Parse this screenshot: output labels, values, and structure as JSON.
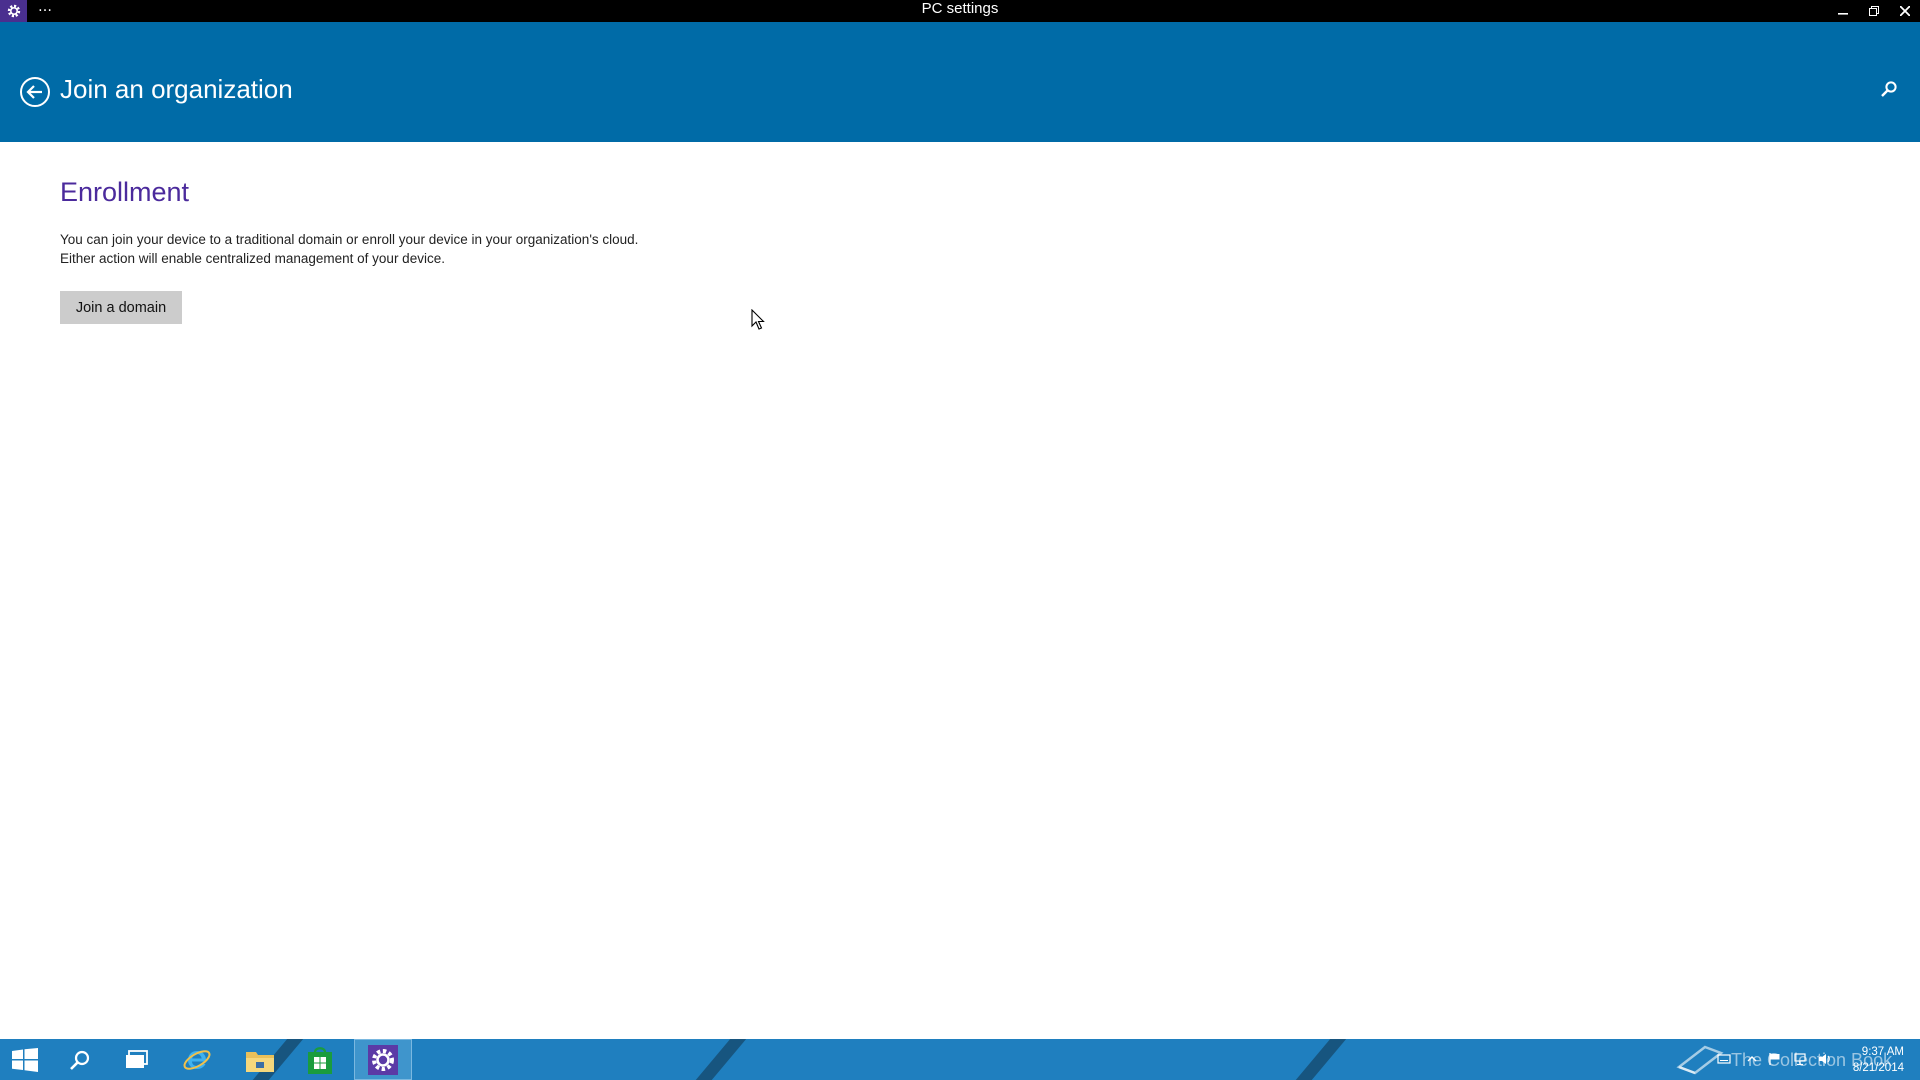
{
  "window": {
    "title": "PC settings",
    "menu_glyph": "…",
    "app_icon": "gear-icon",
    "controls": [
      "minimize-icon",
      "restore-icon",
      "close-icon"
    ]
  },
  "header": {
    "back_icon": "back-arrow-icon",
    "title": "Join an organization",
    "search_icon": "search-icon"
  },
  "content": {
    "heading": "Enrollment",
    "description": "You can join your device to a traditional domain or enroll your device in your organization's cloud.  Either action will enable centralized management of your device.",
    "join_button_label": "Join a domain"
  },
  "taskbar": {
    "items": [
      "start-icon",
      "search-icon",
      "task-view-icon",
      "internet-explorer-icon",
      "file-explorer-icon",
      "store-icon",
      "pc-settings-icon"
    ],
    "active_item": "pc-settings-icon",
    "tray": {
      "watermark": "The Collection Book",
      "time": "9:37 AM",
      "date": "8/21/2014"
    }
  },
  "colors": {
    "header_bg": "#006ba7",
    "heading_accent": "#4b2a9c",
    "taskbar_bg": "#1f7fbf",
    "button_bg": "#cccccc"
  }
}
